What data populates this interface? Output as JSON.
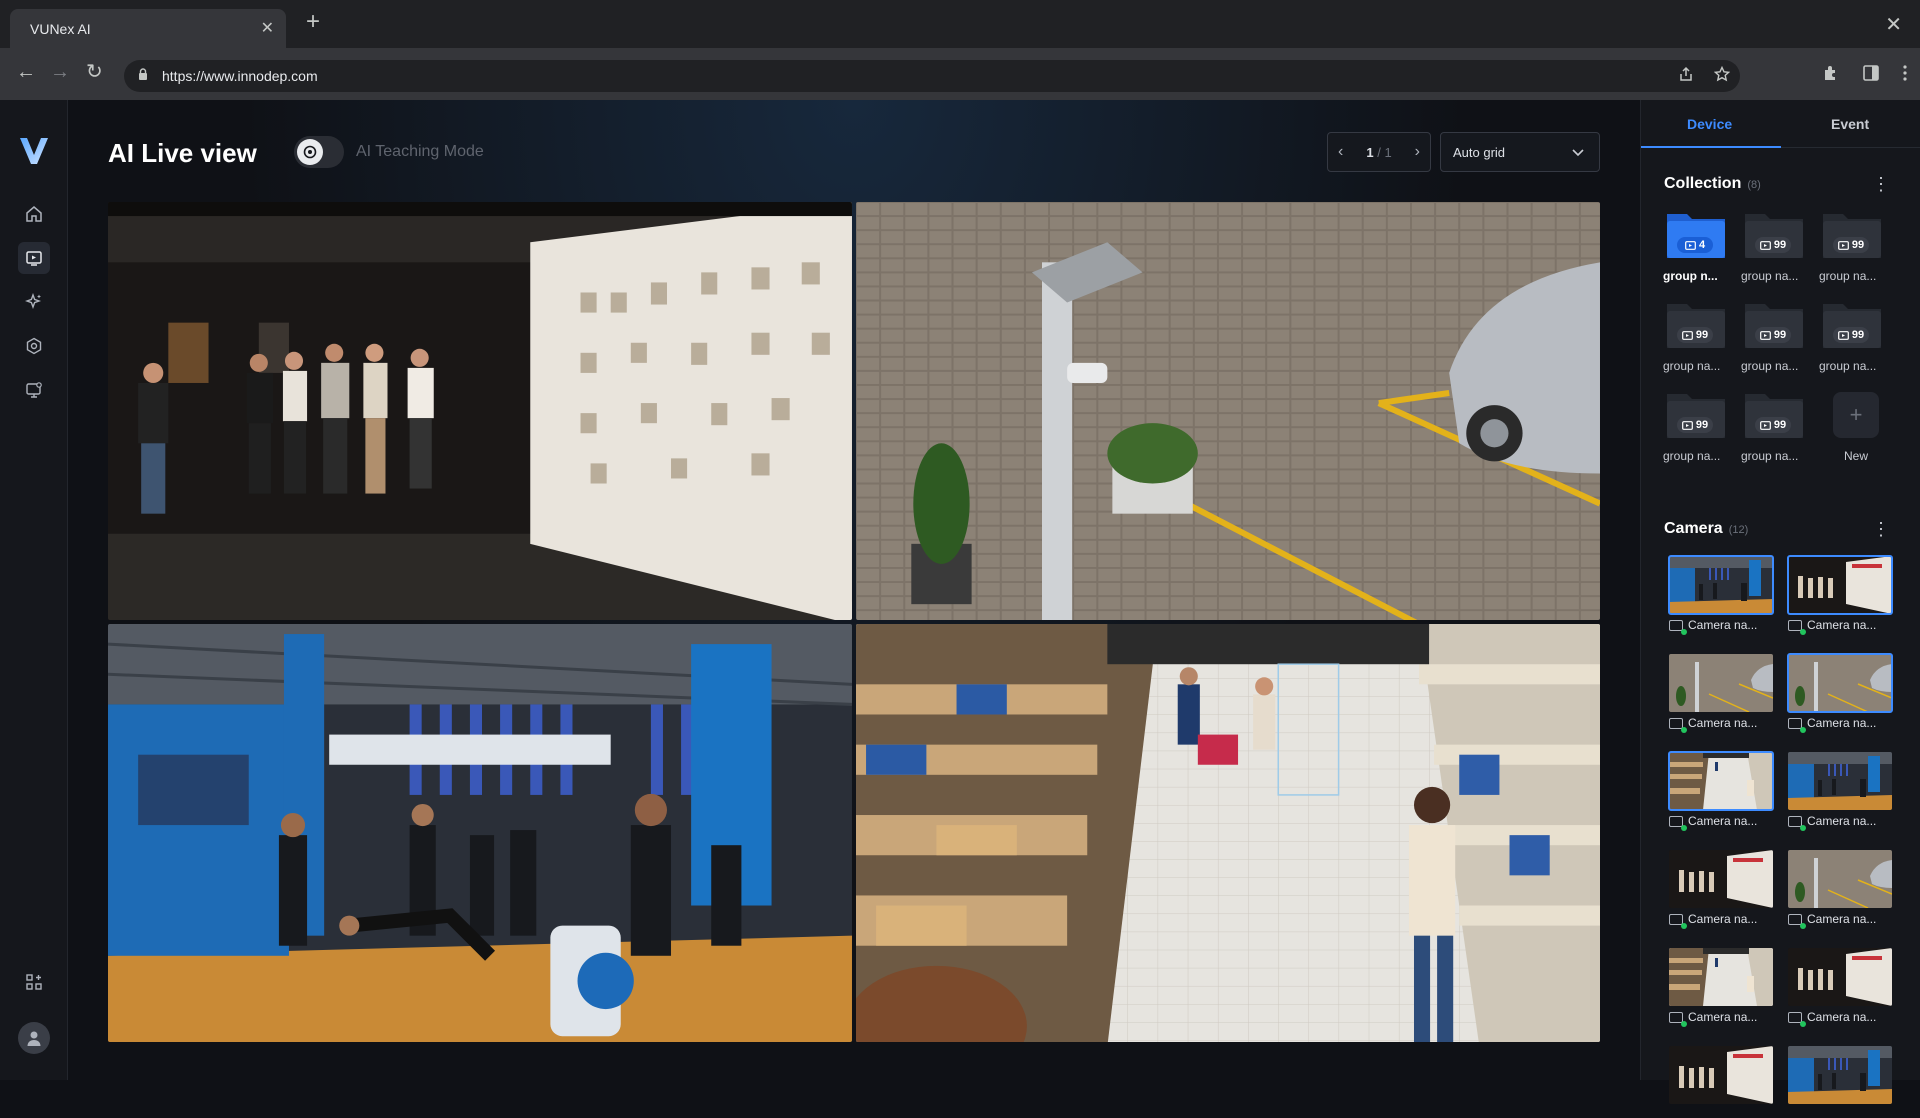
{
  "browser": {
    "tab_title": "VUNex AI",
    "tab_close": "✕",
    "new_tab": "+",
    "window_close": "✕",
    "url": "https://www.innodep.com",
    "nav": {
      "back": "←",
      "forward": "→",
      "reload": "↻"
    },
    "omni_icons": [
      "share-icon",
      "star-icon"
    ],
    "ext_icons": [
      "puzzle-icon",
      "sidepanel-icon",
      "menu-icon"
    ]
  },
  "sidebar": {
    "logo": "V",
    "items": [
      {
        "name": "home-icon",
        "active": false
      },
      {
        "name": "live-view-icon",
        "active": true
      },
      {
        "name": "ai-sparkle-icon",
        "active": false
      },
      {
        "name": "settings-icon",
        "active": false
      },
      {
        "name": "monitor-icon",
        "active": false
      }
    ],
    "bottom_icon": "apps-icon",
    "avatar_icon": "user-icon"
  },
  "header": {
    "title": "AI Live view",
    "teaching_mode_label": "AI Teaching Mode",
    "teaching_mode_on": false,
    "pager": {
      "current": "1",
      "separator": "/",
      "total": "1"
    },
    "grid_select": {
      "value": "Auto grid"
    }
  },
  "video_tiles": [
    {
      "name": "museum-exhibition"
    },
    {
      "name": "parking-lot-camera-pole"
    },
    {
      "name": "trade-show-hall"
    },
    {
      "name": "supermarket-aisle"
    }
  ],
  "panel": {
    "tabs": [
      "Device",
      "Event"
    ],
    "active_tab": "Device",
    "collection": {
      "title": "Collection",
      "count": "(8)",
      "more_icon": "⋮",
      "groups": [
        {
          "label": "group n...",
          "count": "4",
          "selected": true
        },
        {
          "label": "group na...",
          "count": "99",
          "selected": false
        },
        {
          "label": "group na...",
          "count": "99",
          "selected": false
        },
        {
          "label": "group na...",
          "count": "99",
          "selected": false
        },
        {
          "label": "group na...",
          "count": "99",
          "selected": false
        },
        {
          "label": "group na...",
          "count": "99",
          "selected": false
        },
        {
          "label": "group na...",
          "count": "99",
          "selected": false
        },
        {
          "label": "group na...",
          "count": "99",
          "selected": false
        }
      ],
      "new_label": "New",
      "new_icon": "+"
    },
    "camera": {
      "title": "Camera",
      "count": "(12)",
      "more_icon": "⋮",
      "items": [
        {
          "label": "Camera na...",
          "scene": "expo",
          "selected": true
        },
        {
          "label": "Camera na...",
          "scene": "museum",
          "selected": true
        },
        {
          "label": "Camera na...",
          "scene": "parking",
          "selected": false
        },
        {
          "label": "Camera na...",
          "scene": "parking",
          "selected": true
        },
        {
          "label": "Camera na...",
          "scene": "market",
          "selected": true
        },
        {
          "label": "Camera na...",
          "scene": "expo",
          "selected": false
        },
        {
          "label": "Camera na...",
          "scene": "museum",
          "selected": false
        },
        {
          "label": "Camera na...",
          "scene": "parking",
          "selected": false
        },
        {
          "label": "Camera na...",
          "scene": "market",
          "selected": false
        },
        {
          "label": "Camera na...",
          "scene": "museum",
          "selected": false
        },
        {
          "label": "",
          "scene": "museum",
          "selected": false
        },
        {
          "label": "",
          "scene": "expo",
          "selected": false
        }
      ]
    }
  },
  "colors": {
    "accent": "#3d8bff",
    "online": "#21c45d",
    "bg": "#0f1116",
    "panel_bg": "#15171c"
  }
}
